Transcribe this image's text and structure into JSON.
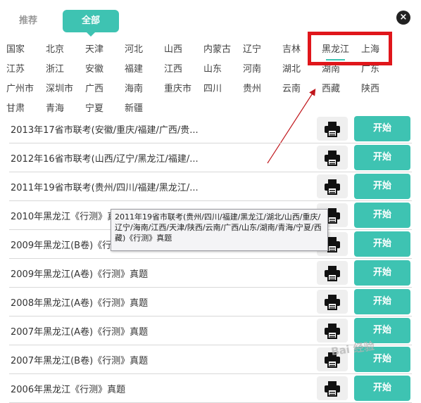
{
  "tabs": {
    "recommend": "推荐",
    "all": "全部"
  },
  "close_label": "×",
  "provinces": [
    "国家",
    "北京",
    "天津",
    "河北",
    "山西",
    "内蒙古",
    "辽宁",
    "吉林",
    "黑龙江",
    "上海",
    "江苏",
    "浙江",
    "安徽",
    "福建",
    "江西",
    "山东",
    "河南",
    "湖北",
    "湖南",
    "广东",
    "广州市",
    "深圳市",
    "广西",
    "海南",
    "重庆市",
    "四川",
    "贵州",
    "云南",
    "西藏",
    "陕西",
    "甘肃",
    "青海",
    "宁夏",
    "新疆"
  ],
  "exams": [
    {
      "title": "2013年17省市联考(安徽/重庆/福建/广西/贵...",
      "start": "开始"
    },
    {
      "title": "2012年16省市联考(山西/辽宁/黑龙江/福建/...",
      "start": "开始"
    },
    {
      "title": "2011年19省市联考(贵州/四川/福建/黑龙江/...",
      "start": "开始"
    },
    {
      "title": "2010年黑龙江《行测》真题",
      "start": "开始"
    },
    {
      "title": "2009年黑龙江(B卷)《行测》真题",
      "start": "开始"
    },
    {
      "title": "2009年黑龙江(A卷)《行测》真题",
      "start": "开始"
    },
    {
      "title": "2008年黑龙江(A卷)《行测》真题",
      "start": "开始"
    },
    {
      "title": "2007年黑龙江(A卷)《行测》真题",
      "start": "开始"
    },
    {
      "title": "2007年黑龙江(B卷)《行测》真题",
      "start": "开始"
    },
    {
      "title": "2006年黑龙江《行测》真题",
      "start": "开始"
    }
  ],
  "tooltip": "2011年19省市联考(贵州/四川/福建/黑龙江/湖北/山西/重庆/辽宁/海南/江西/天津/陕西/云南/广西/山东/湖南/青海/宁夏/西藏)《行测》真题",
  "watermark": "Bai 经验",
  "colors": {
    "accent": "#3ec3b2",
    "highlight_box": "#e0161b"
  }
}
